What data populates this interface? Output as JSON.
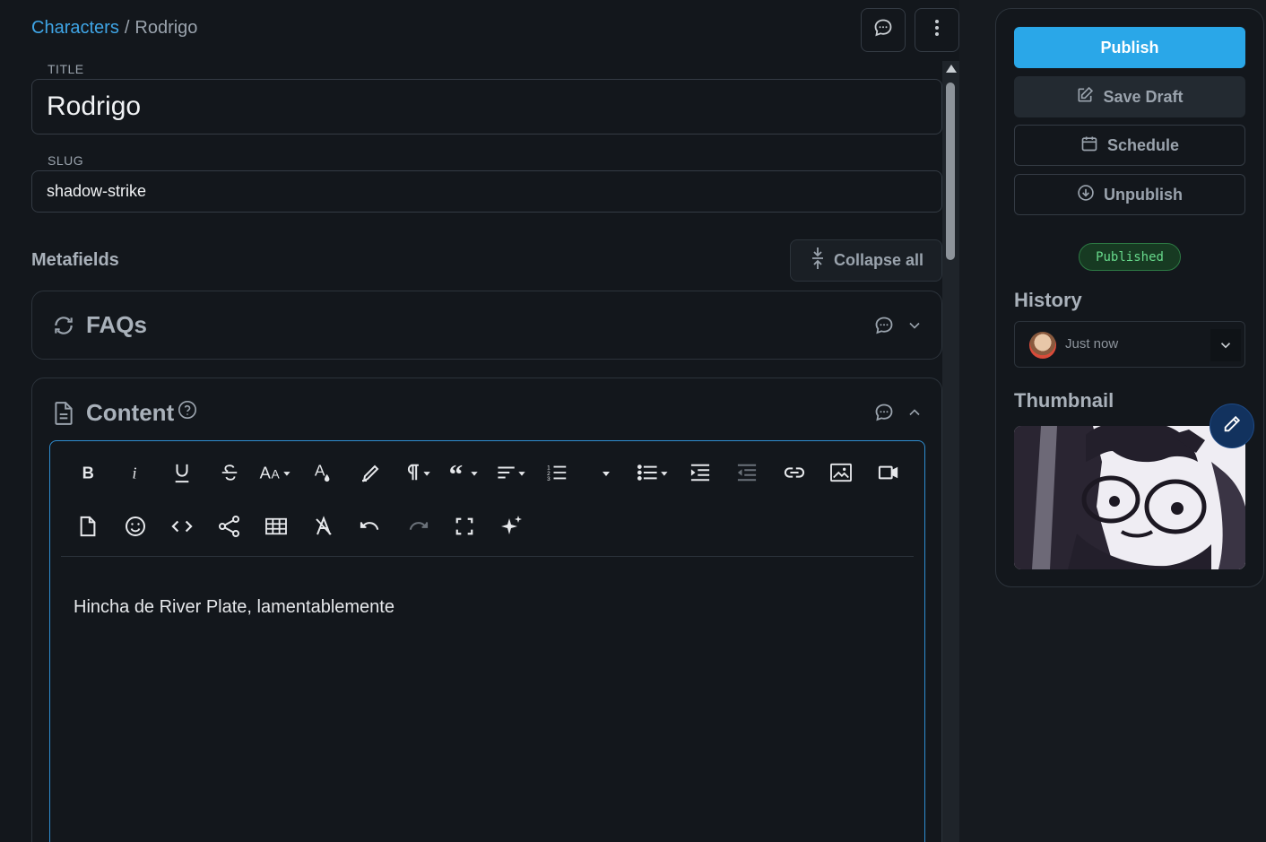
{
  "breadcrumb": {
    "parent": "Characters",
    "separator": "/",
    "current": "Rodrigo"
  },
  "fields": {
    "title": {
      "label": "TITLE",
      "value": "Rodrigo"
    },
    "slug": {
      "label": "SLUG",
      "value": "shadow-strike"
    }
  },
  "metafields": {
    "heading": "Metafields",
    "collapse_label": "Collapse all"
  },
  "faqs": {
    "title": "FAQs"
  },
  "content": {
    "title": "Content",
    "body": "Hincha de River Plate, lamentablemente"
  },
  "sidebar": {
    "publish_label": "Publish",
    "save_draft_label": "Save Draft",
    "schedule_label": "Schedule",
    "unpublish_label": "Unpublish",
    "status": "Published",
    "history_heading": "History",
    "history_value": "Just now",
    "thumbnail_heading": "Thumbnail"
  },
  "colors": {
    "accent": "#2aa7e8",
    "link": "#3fa5e6",
    "status_green": "#67d98b",
    "editor_border": "#2f8ed1"
  },
  "icons": [
    "comment-icon",
    "more-vertical-icon",
    "collapse-icon",
    "sync-icon",
    "chevron-down-icon",
    "document-icon",
    "help-icon",
    "chevron-up-icon",
    "edit-icon",
    "calendar-icon",
    "download-circle-icon",
    "pencil-icon"
  ],
  "toolbar": {
    "row1": [
      "bold",
      "italic",
      "underline",
      "strikethrough",
      "font-size",
      "font-color",
      "highlight",
      "paragraph-format",
      "quote",
      "align",
      "ordered-list",
      "unordered-list",
      "indent",
      "outdent",
      "link",
      "image",
      "video"
    ],
    "row2": [
      "file",
      "emoticon",
      "code-view",
      "share",
      "table",
      "clear-format",
      "undo",
      "redo",
      "fullscreen",
      "ai-assist"
    ]
  }
}
